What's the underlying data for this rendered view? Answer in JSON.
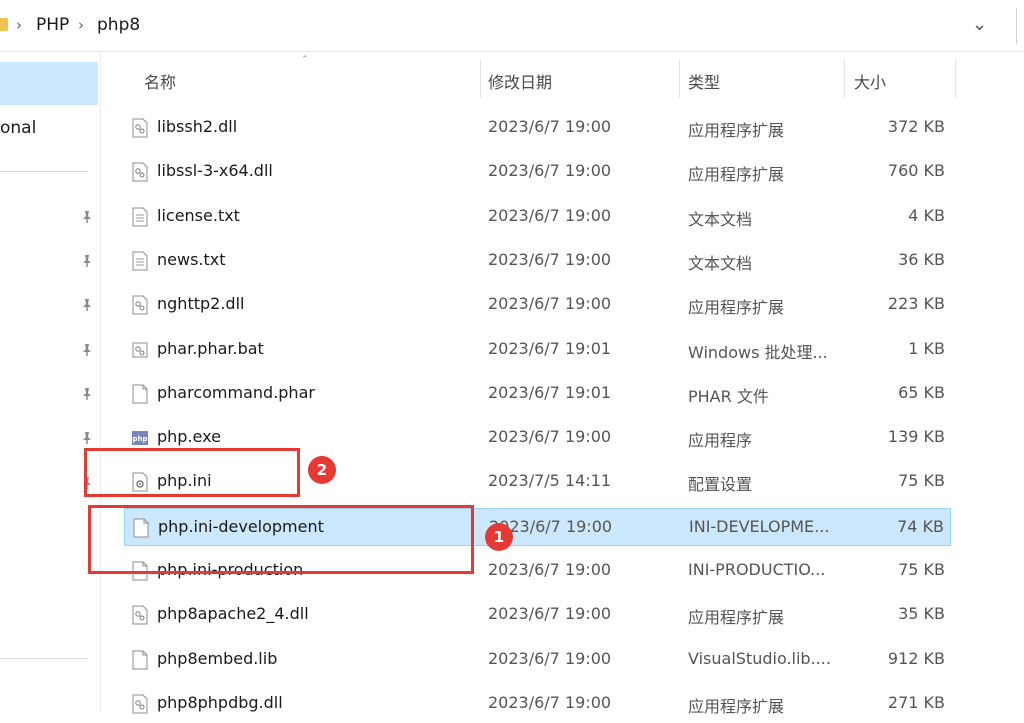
{
  "breadcrumb": {
    "items": [
      "PHP",
      "php8"
    ],
    "separator": "›"
  },
  "nav": {
    "partial_item": "onal"
  },
  "columns": {
    "name": "名称",
    "date": "修改日期",
    "type": "类型",
    "size": "大小"
  },
  "files": [
    {
      "name": "libssh2.dll",
      "date": "2023/6/7 19:00",
      "type": "应用程序扩展",
      "size": "372 KB",
      "icon": "dll-icon"
    },
    {
      "name": "libssl-3-x64.dll",
      "date": "2023/6/7 19:00",
      "type": "应用程序扩展",
      "size": "760 KB",
      "icon": "dll-icon"
    },
    {
      "name": "license.txt",
      "date": "2023/6/7 19:00",
      "type": "文本文档",
      "size": "4 KB",
      "icon": "text-file-icon"
    },
    {
      "name": "news.txt",
      "date": "2023/6/7 19:00",
      "type": "文本文档",
      "size": "36 KB",
      "icon": "text-file-icon"
    },
    {
      "name": "nghttp2.dll",
      "date": "2023/6/7 19:00",
      "type": "应用程序扩展",
      "size": "223 KB",
      "icon": "dll-icon"
    },
    {
      "name": "phar.phar.bat",
      "date": "2023/6/7 19:01",
      "type": "Windows 批处理...",
      "size": "1 KB",
      "icon": "batch-file-icon"
    },
    {
      "name": "pharcommand.phar",
      "date": "2023/6/7 19:01",
      "type": "PHAR 文件",
      "size": "65 KB",
      "icon": "blank-file-icon"
    },
    {
      "name": "php.exe",
      "date": "2023/6/7 19:00",
      "type": "应用程序",
      "size": "139 KB",
      "icon": "php-exe-icon"
    },
    {
      "name": "php.ini",
      "date": "2023/7/5 14:11",
      "type": "配置设置",
      "size": "75 KB",
      "icon": "config-file-icon"
    },
    {
      "name": "php.ini-development",
      "date": "2023/6/7 19:00",
      "type": "INI-DEVELOPME...",
      "size": "74 KB",
      "icon": "blank-file-icon",
      "selected": true
    },
    {
      "name": "php.ini-production",
      "date": "2023/6/7 19:00",
      "type": "INI-PRODUCTIO...",
      "size": "75 KB",
      "icon": "blank-file-icon"
    },
    {
      "name": "php8apache2_4.dll",
      "date": "2023/6/7 19:00",
      "type": "应用程序扩展",
      "size": "35 KB",
      "icon": "dll-icon"
    },
    {
      "name": "php8embed.lib",
      "date": "2023/6/7 19:00",
      "type": "VisualStudio.lib....",
      "size": "912 KB",
      "icon": "blank-file-icon"
    },
    {
      "name": "php8phpdbg.dll",
      "date": "2023/6/7 19:00",
      "type": "应用程序扩展",
      "size": "271 KB",
      "icon": "dll-icon"
    }
  ],
  "annotations": [
    {
      "label": "2"
    },
    {
      "label": "1"
    }
  ],
  "colors": {
    "selection": "#cce8ff",
    "annotation": "#e53935",
    "folder": "#f2c14e"
  }
}
